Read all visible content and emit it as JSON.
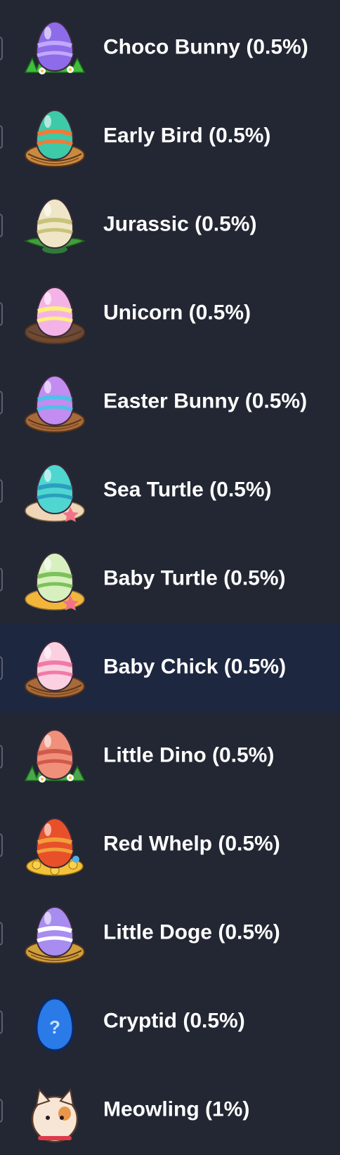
{
  "egg_list": {
    "items": [
      {
        "label": "Choco Bunny (0.5%)",
        "icon": "choco-bunny-egg-icon",
        "egg_color": "#8e6be8",
        "egg_pattern_color": "#c0a8ff",
        "base": "grass",
        "base_color": "#3fbf3a",
        "highlighted": false
      },
      {
        "label": "Early Bird (0.5%)",
        "icon": "early-bird-egg-icon",
        "egg_color": "#3ec9a8",
        "egg_pattern_color": "#f07a3a",
        "base": "nest",
        "base_color": "#c9893f",
        "highlighted": false
      },
      {
        "label": "Jurassic (0.5%)",
        "icon": "jurassic-egg-icon",
        "egg_color": "#efe6c8",
        "egg_pattern_color": "#c9c27a",
        "base": "fern",
        "base_color": "#3f9f3a",
        "highlighted": false
      },
      {
        "label": "Unicorn (0.5%)",
        "icon": "unicorn-egg-icon",
        "egg_color": "#f4b3e6",
        "egg_pattern_color": "#fff07a",
        "base": "nest",
        "base_color": "#6a4a3a",
        "highlighted": false
      },
      {
        "label": "Easter Bunny (0.5%)",
        "icon": "easter-bunny-egg-icon",
        "egg_color": "#c38cf0",
        "egg_pattern_color": "#4fc0e8",
        "base": "nest",
        "base_color": "#a86a3a",
        "highlighted": false
      },
      {
        "label": "Sea Turtle (0.5%)",
        "icon": "sea-turtle-egg-icon",
        "egg_color": "#4fd6d0",
        "egg_pattern_color": "#2a9fc0",
        "base": "sand",
        "base_color": "#efd6b8",
        "highlighted": false
      },
      {
        "label": "Baby Turtle (0.5%)",
        "icon": "baby-turtle-egg-icon",
        "egg_color": "#d8f0c0",
        "egg_pattern_color": "#7cc25a",
        "base": "sand",
        "base_color": "#f2b63a",
        "highlighted": false
      },
      {
        "label": "Baby Chick (0.5%)",
        "icon": "baby-chick-egg-icon",
        "egg_color": "#fbd0e0",
        "egg_pattern_color": "#f07aa8",
        "base": "nest",
        "base_color": "#a86a3a",
        "highlighted": true
      },
      {
        "label": "Little Dino (0.5%)",
        "icon": "little-dino-egg-icon",
        "egg_color": "#f0907a",
        "egg_pattern_color": "#d05a4a",
        "base": "grass",
        "base_color": "#4aa84a",
        "highlighted": false
      },
      {
        "label": "Red Whelp (0.5%)",
        "icon": "red-whelp-egg-icon",
        "egg_color": "#e8502a",
        "egg_pattern_color": "#f0a03a",
        "base": "coins",
        "base_color": "#f2c23a",
        "highlighted": false
      },
      {
        "label": "Little Doge (0.5%)",
        "icon": "little-doge-egg-icon",
        "egg_color": "#a88cf0",
        "egg_pattern_color": "#ffffff",
        "base": "nest",
        "base_color": "#d0a03a",
        "highlighted": false
      },
      {
        "label": "Cryptid (0.5%)",
        "icon": "cryptid-egg-icon",
        "egg_color": "#2a7ae8",
        "egg_pattern_color": "#c8e0ff",
        "base": "none",
        "base_color": "#1a4aa8",
        "highlighted": false
      },
      {
        "label": "Meowling (1%)",
        "icon": "meowling-cat-icon",
        "egg_color": "#f7e6d6",
        "egg_pattern_color": "#e8964a",
        "base": "none",
        "base_color": "#e03a4a",
        "highlighted": false
      }
    ]
  }
}
